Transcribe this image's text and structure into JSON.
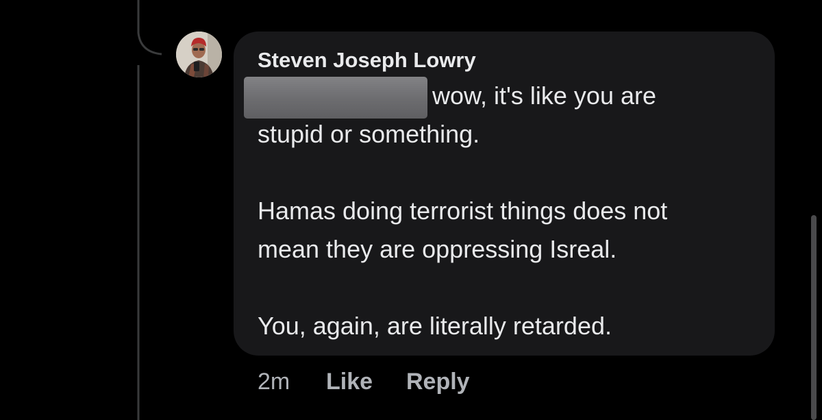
{
  "comment": {
    "author": "Steven Joseph Lowry",
    "lines": [
      "wow, it's like you are",
      "stupid or something.",
      "Hamas doing terrorist things does not",
      "mean they are oppressing Isreal.",
      "You, again, are literally retarded."
    ],
    "timestamp": "2m",
    "like_label": "Like",
    "reply_label": "Reply"
  },
  "colors": {
    "background": "#000000",
    "bubble": "#18181a",
    "text": "#e9eaec",
    "secondary_text": "#b0b3b8",
    "thread_line": "#3a3b3c"
  },
  "icons": {
    "avatar": "profile-photo"
  }
}
